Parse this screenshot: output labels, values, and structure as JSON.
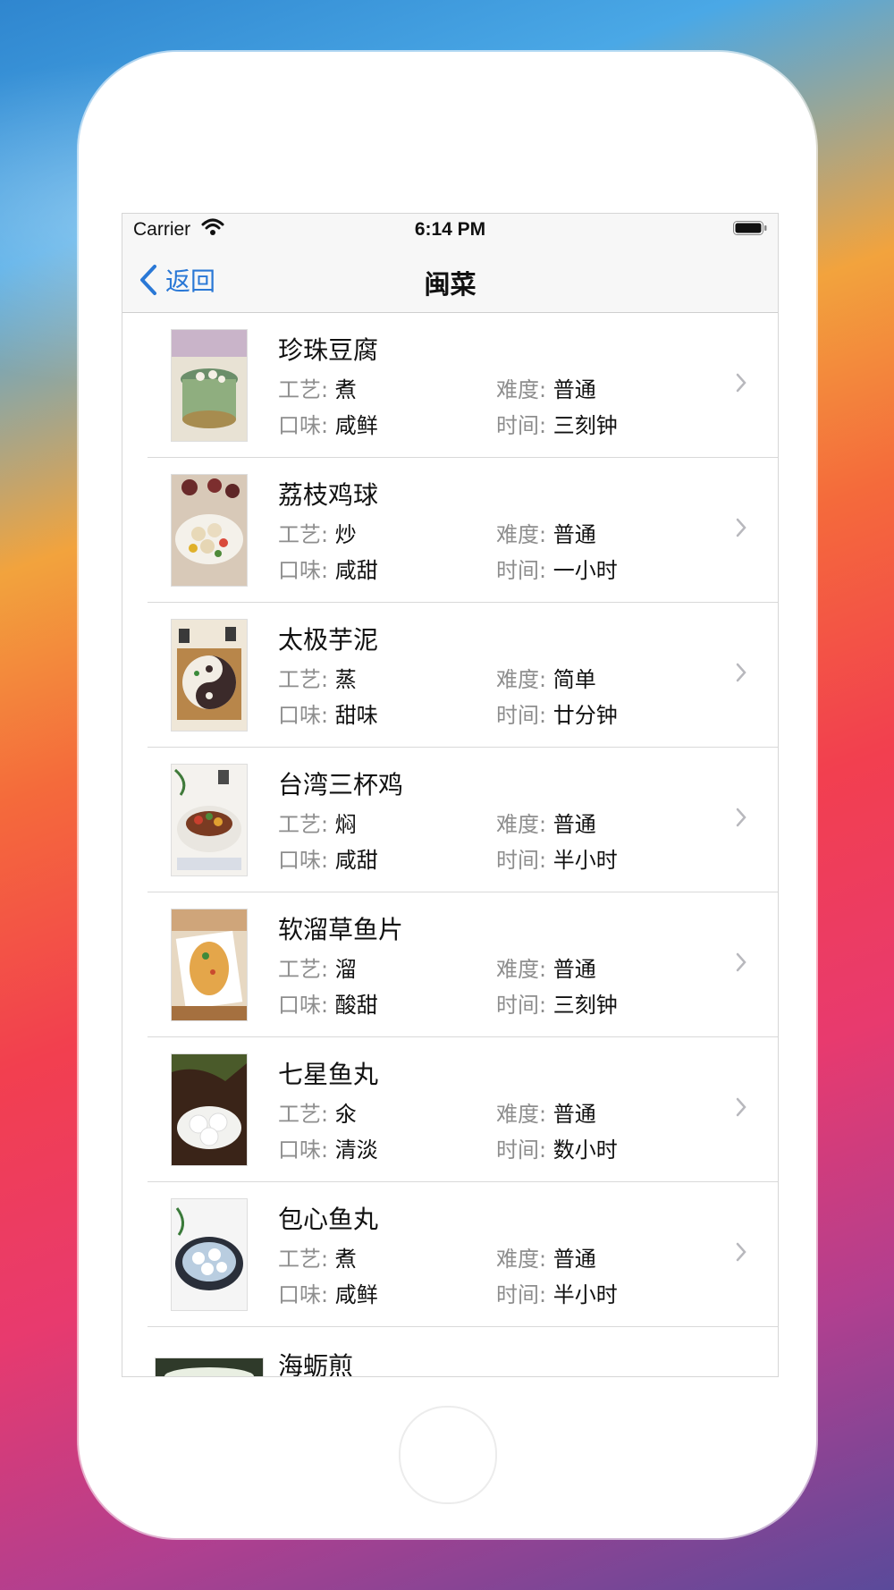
{
  "status_bar": {
    "carrier": "Carrier",
    "time": "6:14 PM"
  },
  "nav": {
    "back_label": "返回",
    "title": "闽菜"
  },
  "labels": {
    "craft": "工艺:",
    "difficulty": "难度:",
    "taste": "口味:",
    "time": "时间:"
  },
  "dishes": [
    {
      "name": "珍珠豆腐",
      "craft": "煮",
      "difficulty": "普通",
      "taste": "咸鲜",
      "time": "三刻钟"
    },
    {
      "name": "荔枝鸡球",
      "craft": "炒",
      "difficulty": "普通",
      "taste": "咸甜",
      "time": "一小时"
    },
    {
      "name": "太极芋泥",
      "craft": "蒸",
      "difficulty": "简单",
      "taste": "甜味",
      "time": "廿分钟"
    },
    {
      "name": "台湾三杯鸡",
      "craft": "焖",
      "difficulty": "普通",
      "taste": "咸甜",
      "time": "半小时"
    },
    {
      "name": "软溜草鱼片",
      "craft": "溜",
      "difficulty": "普通",
      "taste": "酸甜",
      "time": "三刻钟"
    },
    {
      "name": "七星鱼丸",
      "craft": "氽",
      "difficulty": "普通",
      "taste": "清淡",
      "time": "数小时"
    },
    {
      "name": "包心鱼丸",
      "craft": "煮",
      "difficulty": "普通",
      "taste": "咸鲜",
      "time": "半小时"
    },
    {
      "name": "海蛎煎"
    }
  ],
  "colors": {
    "accent": "#2a78d6",
    "secondary_text": "#8e8e8e"
  }
}
